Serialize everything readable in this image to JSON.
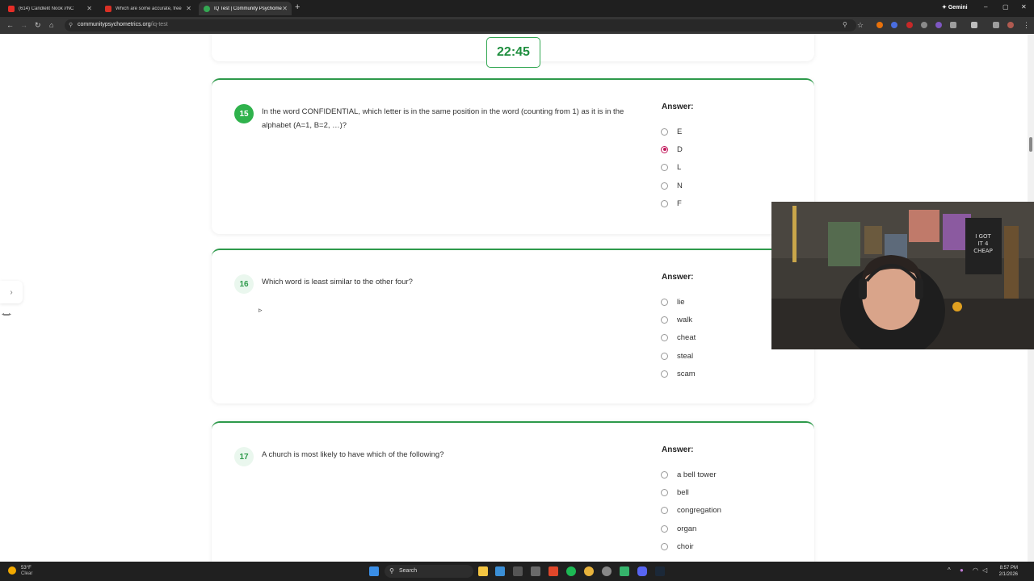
{
  "browser": {
    "tabs": [
      {
        "title": "(614) Candlelit Nook //NC",
        "fav_color": "#e52d27"
      },
      {
        "title": "Which are some accurate, free",
        "fav_color": "#d93025"
      },
      {
        "title": "IQ Test | Community Psychome",
        "fav_color": "#34a853",
        "active": true
      }
    ],
    "gemini_label": "Gemini",
    "url_host": "communitypsychometrics.org",
    "url_path": "/iq-test"
  },
  "timer": "22:45",
  "questions": [
    {
      "number": "15",
      "text": "In the word CONFIDENTIAL, which letter is in the same position in the word (counting from 1) as it is in the alphabet (A=1, B=2, …)?",
      "answer_label": "Answer:",
      "options": [
        "E",
        "D",
        "L",
        "N",
        "F"
      ],
      "selected": 1
    },
    {
      "number": "16",
      "text": "Which word is least similar to the other four?",
      "answer_label": "Answer:",
      "options": [
        "lie",
        "walk",
        "cheat",
        "steal",
        "scam"
      ],
      "selected": -1
    },
    {
      "number": "17",
      "text": "A church is most likely to have which of the following?",
      "answer_label": "Answer:",
      "options": [
        "a bell tower",
        "bell",
        "congregation",
        "organ",
        "choir"
      ],
      "selected": -1
    }
  ],
  "taskbar": {
    "weather_temp": "53°F",
    "weather_cond": "Clear",
    "search_label": "Search",
    "time": "8:57 PM",
    "date": "2/1/2026"
  }
}
